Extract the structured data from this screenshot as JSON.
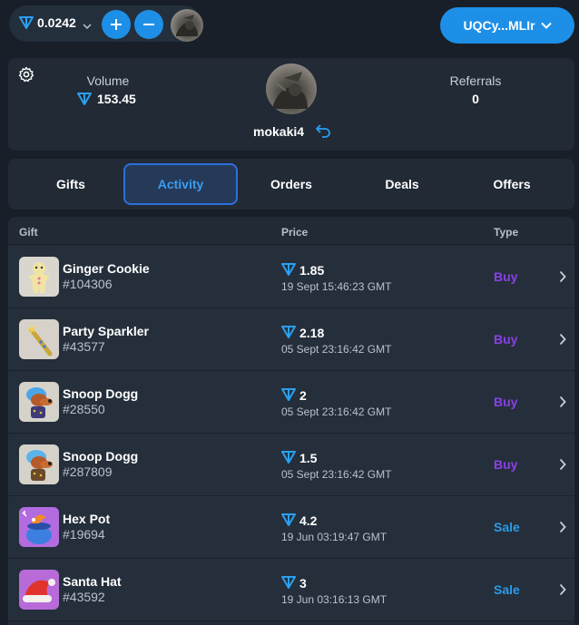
{
  "header": {
    "balance": "0.0242",
    "wallet_address": "UQCy...MLIr"
  },
  "profile": {
    "volume_label": "Volume",
    "volume_value": "153.45",
    "referrals_label": "Referrals",
    "referrals_value": "0",
    "username": "mokaki4"
  },
  "tabs": [
    {
      "label": "Gifts",
      "active": false
    },
    {
      "label": "Activity",
      "active": true
    },
    {
      "label": "Orders",
      "active": false
    },
    {
      "label": "Deals",
      "active": false
    },
    {
      "label": "Offers",
      "active": false
    }
  ],
  "table": {
    "columns": {
      "gift": "Gift",
      "price": "Price",
      "type": "Type"
    },
    "rows": [
      {
        "name": "Ginger Cookie",
        "number": "#104306",
        "price": "1.85",
        "date": "19 Sept 15:46:23 GMT",
        "type": "Buy"
      },
      {
        "name": "Party Sparkler",
        "number": "#43577",
        "price": "2.18",
        "date": "05 Sept 23:16:42 GMT",
        "type": "Buy"
      },
      {
        "name": "Snoop Dogg",
        "number": "#28550",
        "price": "2",
        "date": "05 Sept 23:16:42 GMT",
        "type": "Buy"
      },
      {
        "name": "Snoop Dogg",
        "number": "#287809",
        "price": "1.5",
        "date": "05 Sept 23:16:42 GMT",
        "type": "Buy"
      },
      {
        "name": "Hex Pot",
        "number": "#19694",
        "price": "4.2",
        "date": "19 Jun 03:19:47 GMT",
        "type": "Sale"
      },
      {
        "name": "Santa Hat",
        "number": "#43592",
        "price": "3",
        "date": "19 Jun 03:16:13 GMT",
        "type": "Sale"
      }
    ]
  },
  "colors": {
    "accent": "#1e8fe6",
    "buy": "#8a3fe8",
    "sale": "#2b9be8",
    "background": "#181f28",
    "card": "#212a35"
  },
  "icons": {
    "currency": "ton-diamond-icon",
    "settings": "gear-icon",
    "share": "share-icon",
    "row_arrow": "chevron-right-icon"
  }
}
